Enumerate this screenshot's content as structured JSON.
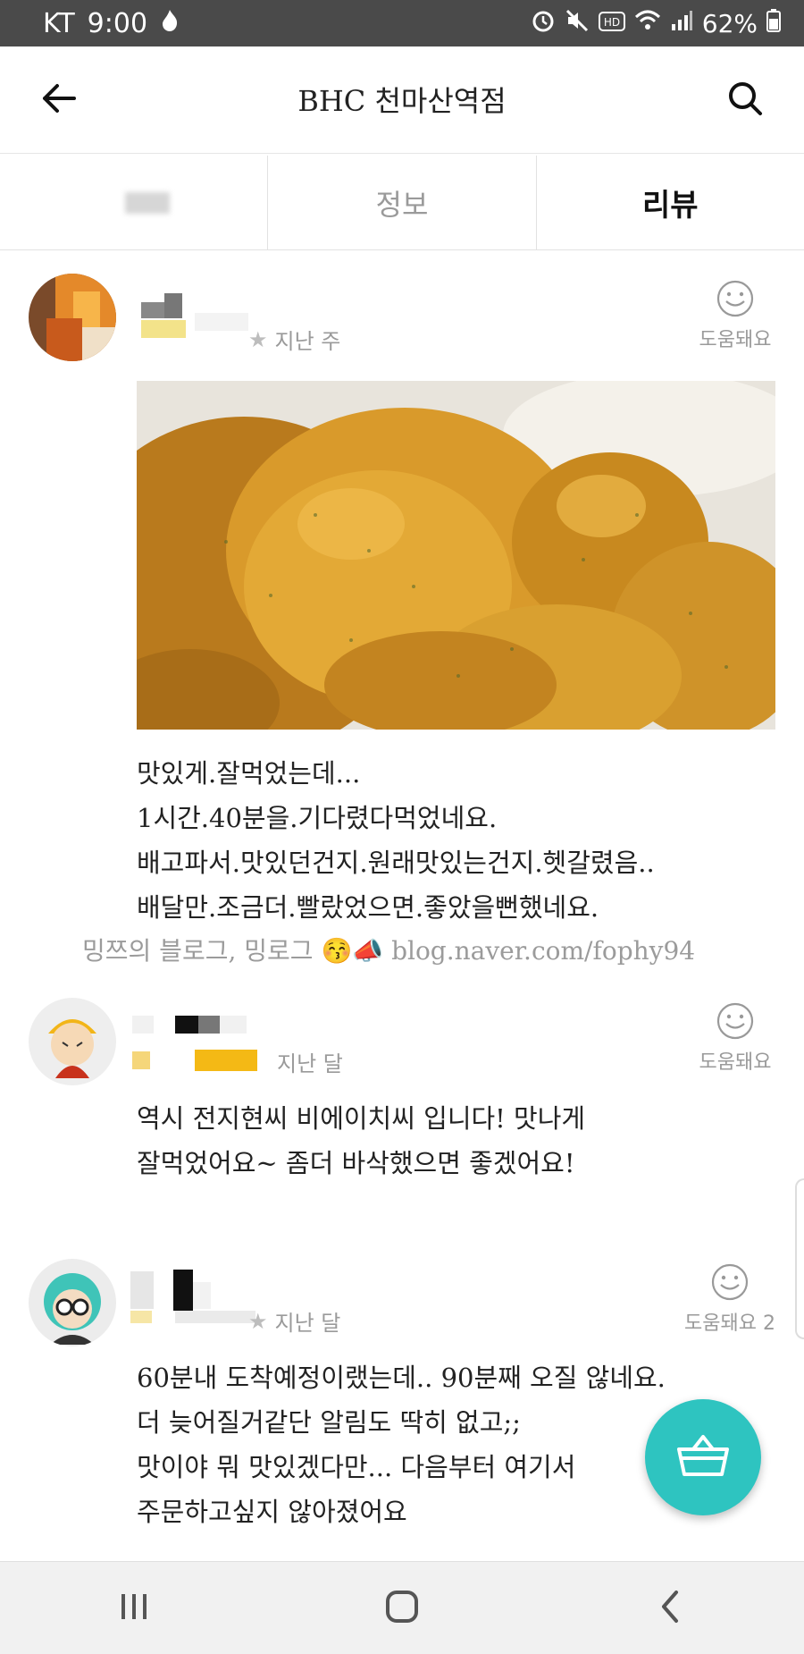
{
  "status_bar": {
    "carrier": "KT",
    "time": "9:00",
    "battery": "62%",
    "icons": [
      "flame-icon",
      "alarm-icon",
      "mute-icon",
      "hd-icon",
      "wifi-icon",
      "signal-icon",
      "battery-icon"
    ]
  },
  "header": {
    "title": "BHC 천마산역점",
    "back_icon": "back-arrow-icon",
    "search_icon": "search-icon"
  },
  "tabs": [
    {
      "label": "",
      "active": false
    },
    {
      "label": "정보",
      "active": false
    },
    {
      "label": "리뷰",
      "active": true
    }
  ],
  "reviews": [
    {
      "time": "지난 주",
      "helpful_label": "도움돼요",
      "text": "맛있게.잘먹었는데...\n1시간.40분을.기다렸다먹었네요.\n배고파서.맛있던건지.원래맛있는건지.헷갈렸음..\n배달만.조금더.빨랐었으면.좋았을뻔했네요.",
      "blog_credit": "밍쯔의 블로그, 밍로그 😚📣 blog.naver.com/fophy94"
    },
    {
      "time": "지난 달",
      "helpful_label": "도움돼요",
      "text": "역시 전지현씨 비에이치씨 입니다! 맛나게\n잘먹었어요~ 좀더 바삭했으면 좋겠어요!"
    },
    {
      "time": "지난 달",
      "helpful_label": "도움돼요 2",
      "text": "60분내 도착예정이랬는데.. 90분째 오질 않네요.\n더 늦어질거같단 알림도 딱히 없고;;\n맛이야 뭐 맛있겠다만... 다음부터 여기서\n주문하고싶지 않아졌어요"
    }
  ],
  "fab": {
    "icon": "shopping-basket-icon"
  },
  "nav_bar": {
    "icons": [
      "recent-apps-icon",
      "home-icon",
      "back-icon"
    ]
  },
  "colors": {
    "accent": "#2ec4c0",
    "status_bar": "#4a4a4a"
  }
}
